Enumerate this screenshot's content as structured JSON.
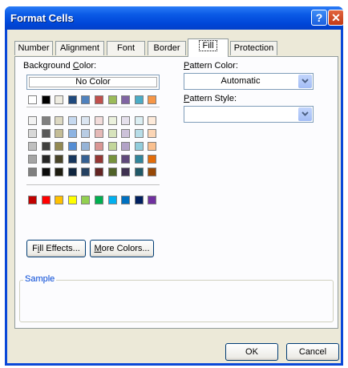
{
  "window": {
    "title": "Format Cells",
    "help_glyph": "?",
    "close_glyph": "✕"
  },
  "tabs": [
    {
      "label": "Number"
    },
    {
      "label": "Alignment"
    },
    {
      "label": "Font"
    },
    {
      "label": "Border"
    },
    {
      "label": "Fill",
      "active": true
    },
    {
      "label": "Protection"
    }
  ],
  "fill": {
    "background_color_label": "Background Color:",
    "no_color_label": "No Color",
    "theme_row": [
      "#ffffff",
      "#000000",
      "#eeece1",
      "#1f497d",
      "#4f81bd",
      "#c0504d",
      "#9bbb59",
      "#8064a2",
      "#4bacc6",
      "#f79646"
    ],
    "tint_rows": [
      [
        "#f2f2f2",
        "#7f7f7f",
        "#ddd9c3",
        "#c6d9f0",
        "#dbe5f1",
        "#f2dcdb",
        "#ebf1dd",
        "#e5e0ec",
        "#dbeef3",
        "#fdeada"
      ],
      [
        "#d8d8d8",
        "#595959",
        "#c4bd97",
        "#8db3e2",
        "#b8cce4",
        "#e5b9b7",
        "#d7e3bc",
        "#ccc1d9",
        "#b7dde8",
        "#fbd5b5"
      ],
      [
        "#bfbfbf",
        "#3f3f3f",
        "#938953",
        "#548dd4",
        "#95b3d7",
        "#d99694",
        "#c3d69b",
        "#b2a2c7",
        "#92cddc",
        "#fac08f"
      ],
      [
        "#a5a5a5",
        "#262626",
        "#494429",
        "#17365d",
        "#366092",
        "#953734",
        "#76923c",
        "#5f497a",
        "#31859b",
        "#e36c09"
      ],
      [
        "#7f7f7f",
        "#0c0c0c",
        "#1d1b10",
        "#0f243e",
        "#244061",
        "#632423",
        "#4f6128",
        "#3f3151",
        "#205867",
        "#974806"
      ]
    ],
    "standard_row": [
      "#c00000",
      "#ff0000",
      "#ffc000",
      "#ffff00",
      "#92d050",
      "#00b050",
      "#00b0f0",
      "#0070c0",
      "#002060",
      "#7030a0"
    ],
    "fill_effects_label": "Fill Effects...",
    "more_colors_label": "More Colors...",
    "pattern_color_label": "Pattern Color:",
    "pattern_color_value": "Automatic",
    "pattern_style_label": "Pattern Style:",
    "pattern_style_value": "",
    "sample_label": "Sample"
  },
  "buttons": {
    "ok_label": "OK",
    "cancel_label": "Cancel"
  }
}
